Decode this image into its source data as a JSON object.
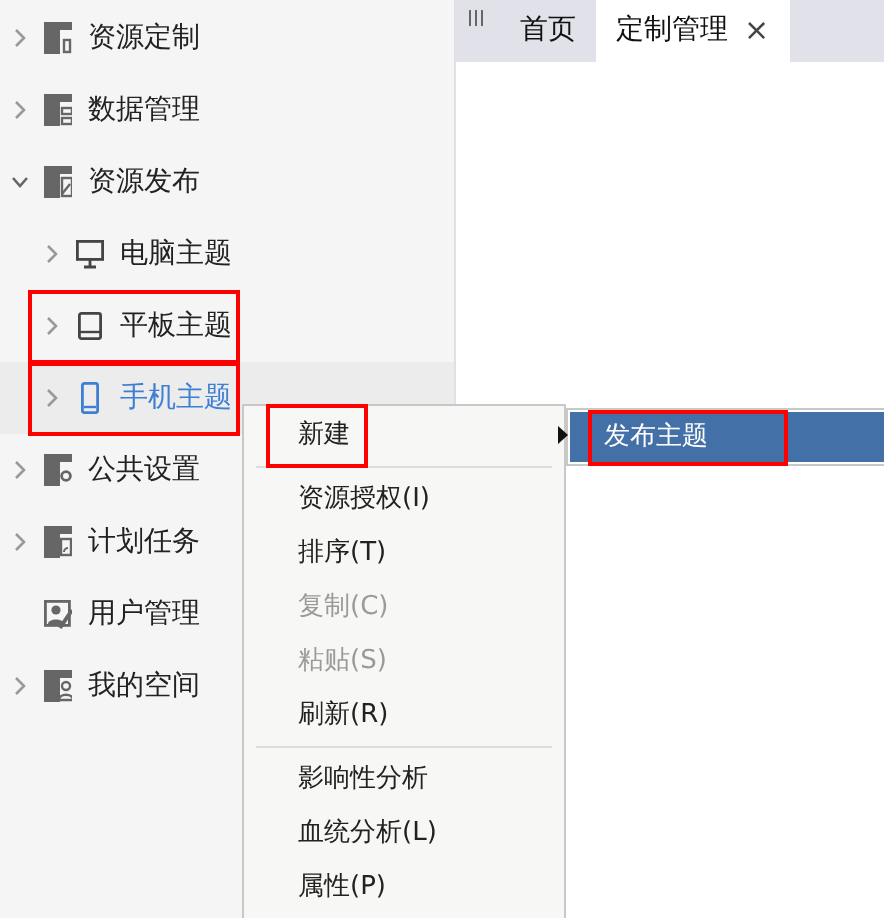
{
  "sidebar": {
    "items": [
      {
        "label": "资源定制",
        "expanded": false,
        "selected": false,
        "highlighted": false
      },
      {
        "label": "数据管理",
        "expanded": false,
        "selected": false,
        "highlighted": false
      },
      {
        "label": "资源发布",
        "expanded": true,
        "selected": false,
        "highlighted": false,
        "children": [
          {
            "label": "电脑主题",
            "expanded": false,
            "selected": false,
            "highlighted": false
          },
          {
            "label": "平板主题",
            "expanded": false,
            "selected": false,
            "highlighted": true
          },
          {
            "label": "手机主题",
            "expanded": false,
            "selected": true,
            "highlighted": true
          }
        ]
      },
      {
        "label": "公共设置",
        "expanded": false,
        "selected": false,
        "highlighted": false
      },
      {
        "label": "计划任务",
        "expanded": false,
        "selected": false,
        "highlighted": false
      },
      {
        "label": "用户管理",
        "selected": false,
        "highlighted": false
      },
      {
        "label": "我的空间",
        "expanded": false,
        "selected": false,
        "highlighted": false
      }
    ]
  },
  "tabs": [
    {
      "label": "首页",
      "selected": false
    },
    {
      "label": "定制管理",
      "selected": true,
      "close": "×"
    }
  ],
  "context_menu": {
    "items": [
      {
        "kind": "item",
        "label": "新建",
        "disabled": false,
        "highlighted": true,
        "submenu": [
          {
            "label": "发布主题",
            "selected": true,
            "highlighted": true
          }
        ]
      },
      {
        "kind": "separator"
      },
      {
        "kind": "item",
        "label": "资源授权(I)",
        "disabled": false,
        "highlighted": false
      },
      {
        "kind": "item",
        "label": "排序(T)",
        "disabled": false,
        "highlighted": false
      },
      {
        "kind": "item",
        "label": "复制(C)",
        "disabled": true,
        "highlighted": false
      },
      {
        "kind": "item",
        "label": "粘贴(S)",
        "disabled": true,
        "highlighted": false
      },
      {
        "kind": "item",
        "label": "刷新(R)",
        "disabled": false,
        "highlighted": false
      },
      {
        "kind": "separator"
      },
      {
        "kind": "item",
        "label": "影响性分析",
        "disabled": false,
        "highlighted": false
      },
      {
        "kind": "item",
        "label": "血统分析(L)",
        "disabled": false,
        "highlighted": false
      },
      {
        "kind": "item",
        "label": "属性(P)",
        "disabled": false,
        "highlighted": false
      }
    ]
  }
}
